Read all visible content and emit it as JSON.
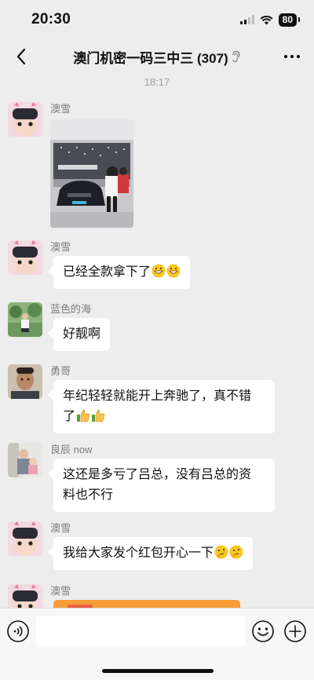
{
  "status_bar": {
    "time": "20:30",
    "battery": "80"
  },
  "nav": {
    "title": "澳门机密一码三中三 (307)"
  },
  "chat": {
    "timestamp": "18:17",
    "messages": [
      {
        "sender": "澳雪",
        "type": "image"
      },
      {
        "sender": "澳雪",
        "text": "已经全款拿下了",
        "emoji": "grin-emoji"
      },
      {
        "sender": "蓝色的海",
        "text": "好靓啊"
      },
      {
        "sender": "勇哥",
        "line1": "年纪轻轻就能开上奔驰了，真不错",
        "line2": "了",
        "emoji": "thumbs-up-emoji"
      },
      {
        "sender": "良辰 now",
        "line1": "这还是多亏了吕总，没有吕总的资",
        "line2": "料也不行"
      },
      {
        "sender": "澳雪",
        "text": "我给大家发个红包开心一下",
        "emoji": "thinking-emoji"
      },
      {
        "sender": "澳雪",
        "type": "red-packet"
      }
    ]
  },
  "input": {
    "placeholder": ""
  }
}
